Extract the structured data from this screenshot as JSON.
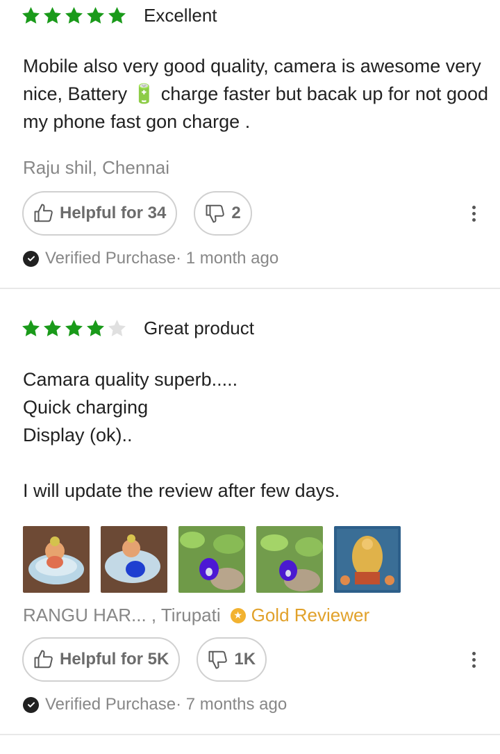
{
  "colors": {
    "star_filled": "#14958f",
    "star_green": "#1a9a1a",
    "star_empty": "#e0e0e0",
    "gold": "#e1a12a"
  },
  "reviews": [
    {
      "rating": 5,
      "title": "Excellent",
      "body": "Mobile also very good quality, camera is awesome very nice, Battery 🔋 charge faster but bacak up for not good my phone fast gon charge .",
      "author": "Raju shil, Chennai",
      "helpful_label": "Helpful for 34",
      "dislike_count": "2",
      "verified": "Verified Purchase",
      "time": "· 1 month ago"
    },
    {
      "rating": 4,
      "title": "Great product",
      "body": "Camara quality superb.....\nQuick charging\nDisplay (ok)..\n\nI will update the review after few days.",
      "author": "RANGU HAR... , Tirupati",
      "badge": "Gold Reviewer",
      "images": [
        "ganesha-idol-photo",
        "ganesha-idol-blue-flower-photo",
        "blue-flower-plant-photo",
        "blue-flower-plant-photo-2",
        "deity-picture-photo"
      ],
      "helpful_label": "Helpful for 5K",
      "dislike_count": "1K",
      "verified": "Verified Purchase",
      "time": "· 7 months ago"
    }
  ]
}
